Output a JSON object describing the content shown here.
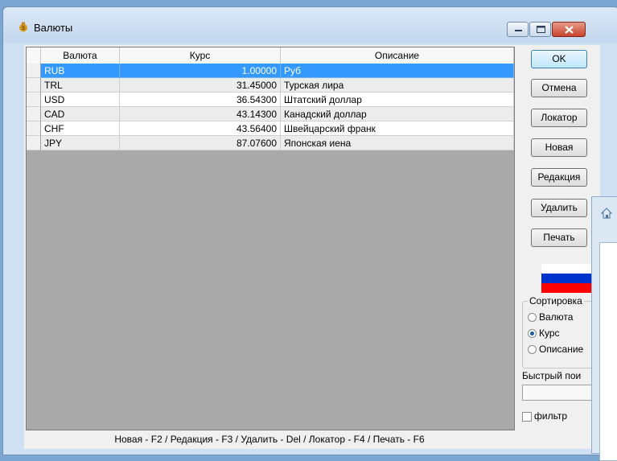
{
  "window": {
    "title": "Валюты"
  },
  "grid": {
    "headers": [
      "Валюта",
      "Курс",
      "Описание"
    ],
    "rows": [
      {
        "code": "RUB",
        "rate": "1.00000",
        "desc": "Руб"
      },
      {
        "code": "TRL",
        "rate": "31.45000",
        "desc": "Турская лира"
      },
      {
        "code": "USD",
        "rate": "36.54300",
        "desc": "Штатский доллар"
      },
      {
        "code": "CAD",
        "rate": "43.14300",
        "desc": "Канадский доллар"
      },
      {
        "code": "CHF",
        "rate": "43.56400",
        "desc": "Швейцарский франк"
      },
      {
        "code": "JPY",
        "rate": "87.07600",
        "desc": "Японская иена"
      }
    ],
    "selected_row": 0
  },
  "buttons": {
    "ok": "OK",
    "cancel": "Отмена",
    "locator": "Локатор",
    "new": "Новая",
    "edit": "Редакция",
    "delete": "Удалить",
    "print": "Печать"
  },
  "sort": {
    "title": "Сортировка",
    "options": [
      "Валюта",
      "Курс",
      "Описание"
    ],
    "selected": 1
  },
  "quick_search": {
    "label": "Быстрый пои",
    "value": ""
  },
  "filter": {
    "label": "фильтр",
    "checked": false
  },
  "status_bar": "Новая - F2 / Редакция - F3 / Удалить - Del / Локатор - F4 / Печать - F6",
  "colors": {
    "selection": "#3399ff",
    "flag_white": "#ffffff",
    "flag_blue": "#0033cc",
    "flag_red": "#ff0000"
  }
}
